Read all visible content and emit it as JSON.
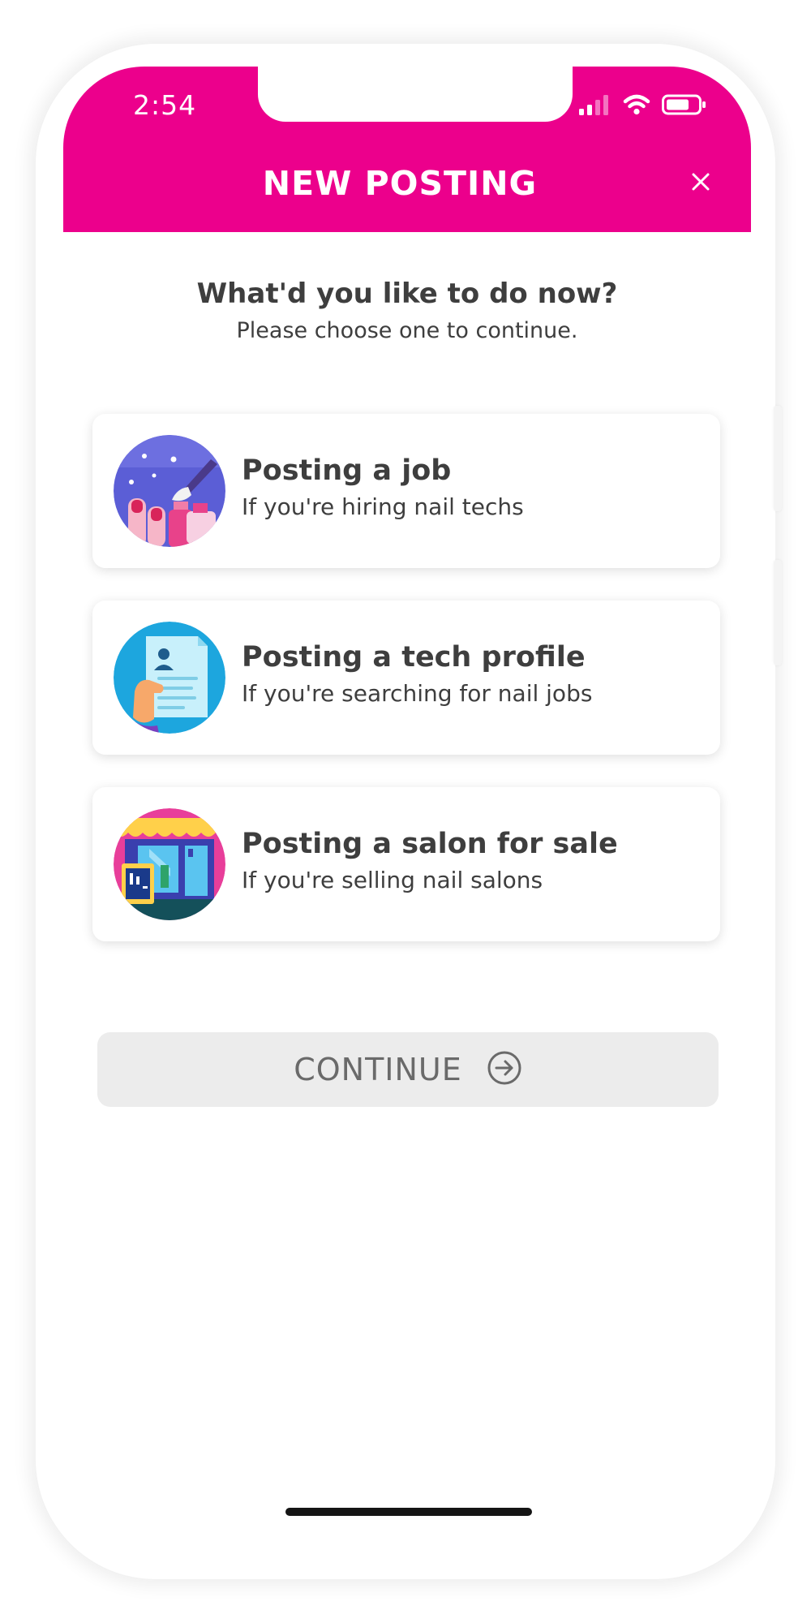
{
  "status_bar": {
    "time": "2:54",
    "icons": [
      "cellular-signal-icon",
      "wifi-icon",
      "battery-icon"
    ]
  },
  "header": {
    "title": "NEW POSTING",
    "close_icon": "close-icon",
    "background_color": "#ec008c"
  },
  "prompt": {
    "heading": "What'd you like to do now?",
    "subheading": "Please choose one to continue."
  },
  "options": [
    {
      "icon": "nail-polish-icon",
      "title": "Posting a job",
      "subtitle": "If you're hiring nail techs"
    },
    {
      "icon": "resume-profile-icon",
      "title": "Posting a tech profile",
      "subtitle": "If you're searching for nail jobs"
    },
    {
      "icon": "salon-storefront-icon",
      "title": "Posting a salon for sale",
      "subtitle": "If you're selling nail salons"
    }
  ],
  "continue_button": {
    "label": "CONTINUE",
    "icon": "arrow-right-circle-icon",
    "state": "disabled"
  },
  "colors": {
    "accent": "#ec008c",
    "text": "#3e3e3e",
    "button_disabled_bg": "#ececec",
    "button_disabled_text": "#6a6a6a"
  }
}
